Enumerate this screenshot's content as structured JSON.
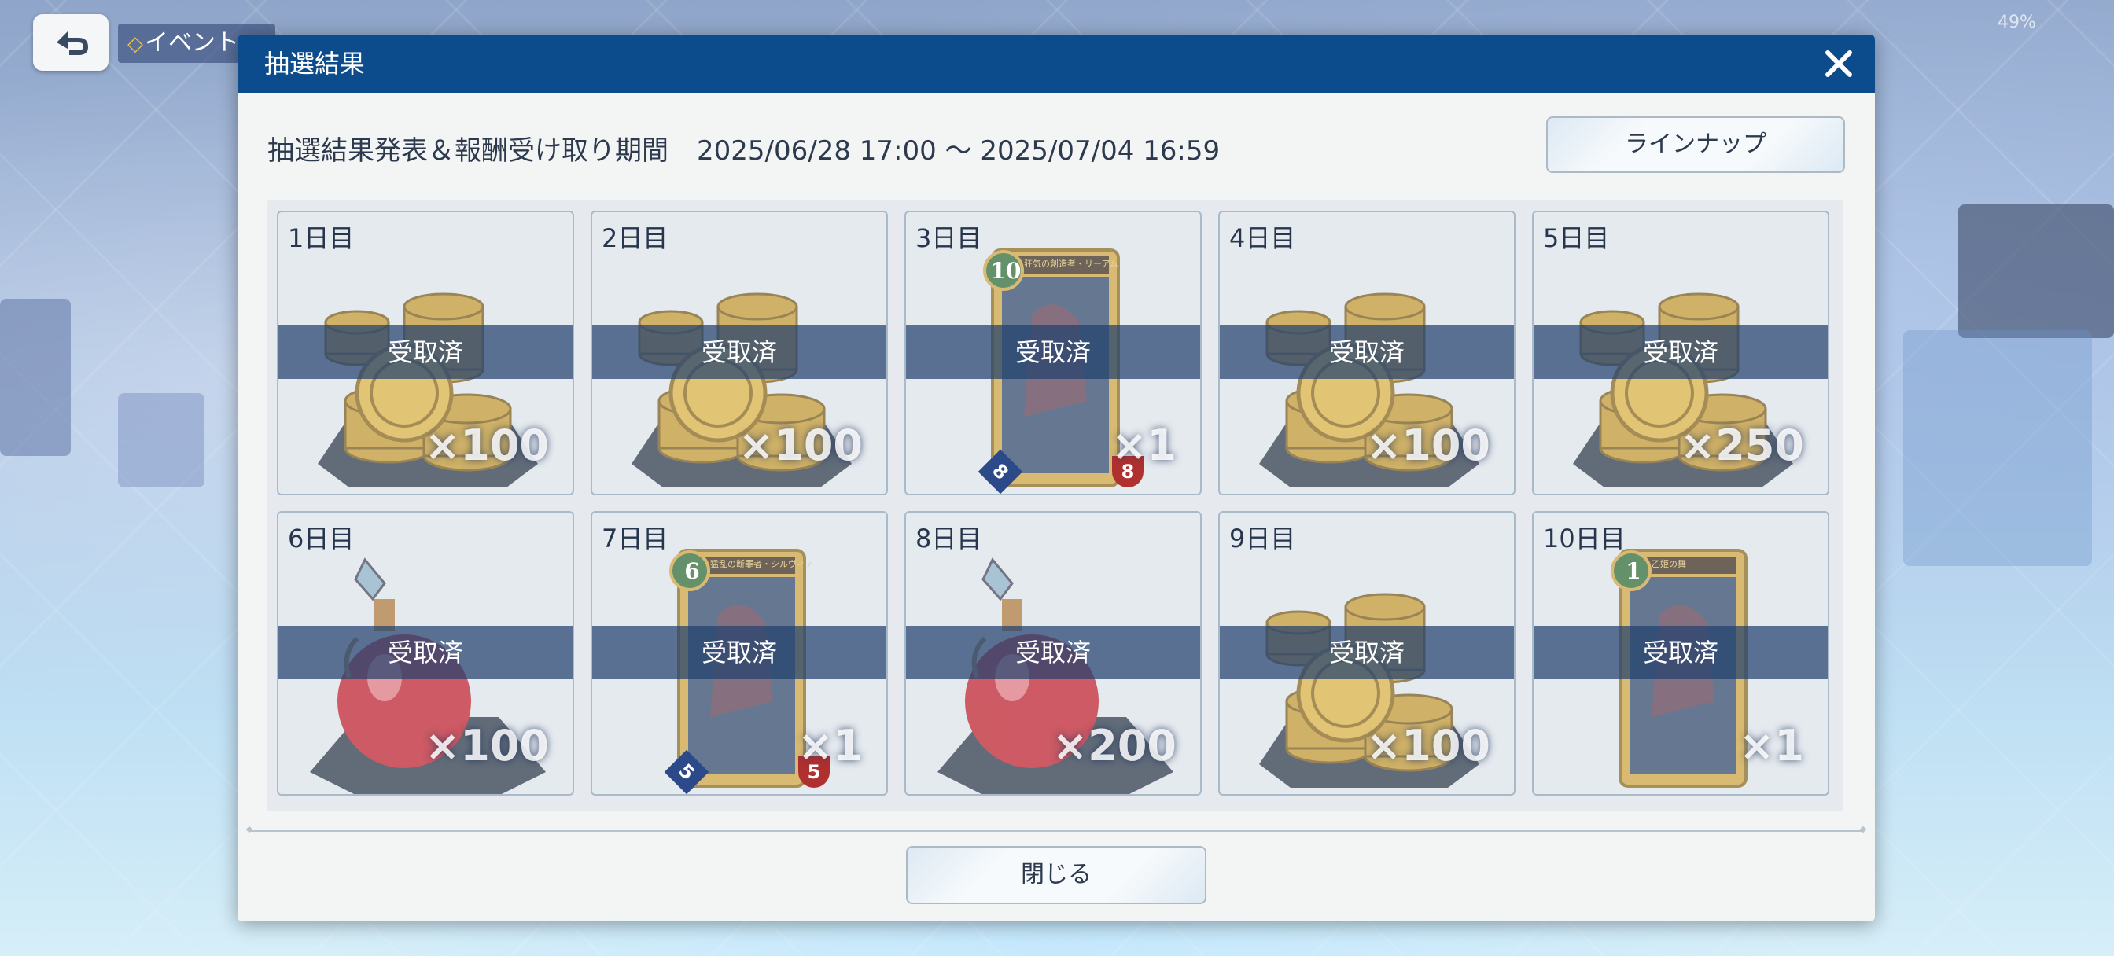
{
  "background": {
    "event_label": "イベント",
    "battery": "49%"
  },
  "dialog": {
    "title": "抽選結果",
    "period_label": "抽選結果発表＆報酬受け取り期間",
    "period_dates": "2025/06/28 17:00 ～ 2025/07/04 16:59",
    "lineup_button": "ラインナップ",
    "close_button": "閉じる",
    "colors": {
      "header": "#0c4c8c",
      "band": "#23416e"
    }
  },
  "days": [
    {
      "label": "1日目",
      "status": "受取済",
      "reward": "coin-stack",
      "qty": "×100"
    },
    {
      "label": "2日目",
      "status": "受取済",
      "reward": "coin-stack",
      "qty": "×100"
    },
    {
      "label": "3日目",
      "status": "受取済",
      "reward": "card",
      "qty": "×1",
      "card_cost": "10",
      "card_atk": "8",
      "card_def": "8",
      "card_name": "狂気の創造者・リーアム"
    },
    {
      "label": "4日目",
      "status": "受取済",
      "reward": "coin-stack",
      "qty": "×100"
    },
    {
      "label": "5日目",
      "status": "受取済",
      "reward": "coin-stack",
      "qty": "×250"
    },
    {
      "label": "6日目",
      "status": "受取済",
      "reward": "potion",
      "qty": "×100"
    },
    {
      "label": "7日目",
      "status": "受取済",
      "reward": "card",
      "qty": "×1",
      "card_cost": "6",
      "card_atk": "5",
      "card_def": "5",
      "card_name": "猛乱の断罪者・シルヴィア"
    },
    {
      "label": "8日目",
      "status": "受取済",
      "reward": "potion",
      "qty": "×200"
    },
    {
      "label": "9日目",
      "status": "受取済",
      "reward": "coin-stack",
      "qty": "×100"
    },
    {
      "label": "10日目",
      "status": "受取済",
      "reward": "card",
      "qty": "×1",
      "card_cost": "1",
      "card_name": "乙姫の舞"
    }
  ]
}
